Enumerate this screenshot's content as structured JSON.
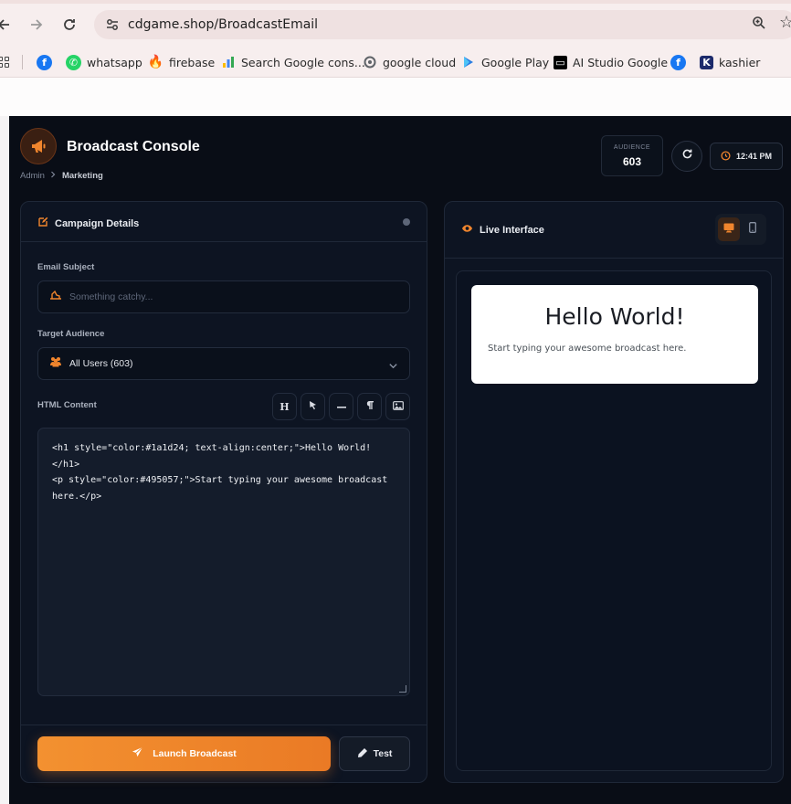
{
  "browser": {
    "url": "cdgame.shop/BroadcastEmail",
    "bookmarks": [
      {
        "label": "",
        "icon": "facebook-icon",
        "color": "#1877f2"
      },
      {
        "label": "whatsapp",
        "icon": "whatsapp-icon",
        "color": "#25d366"
      },
      {
        "label": "firebase",
        "icon": "firebase-icon",
        "color": "#f5820d"
      },
      {
        "label": "Search Google cons...",
        "icon": "google-ads-icon",
        "color": "#4285f4"
      },
      {
        "label": "google cloud",
        "icon": "google-cloud-icon",
        "color": "#5f6368"
      },
      {
        "label": "Google Play",
        "icon": "google-play-icon",
        "color": "#2a7de1"
      },
      {
        "label": "AI Studio Google",
        "icon": "ai-studio-icon",
        "color": "#000000"
      },
      {
        "label": "",
        "icon": "facebook-icon",
        "color": "#1877f2"
      },
      {
        "label": "kashier",
        "icon": "kashier-icon",
        "color": "#1c2a6b"
      }
    ]
  },
  "header": {
    "title": "Broadcast Console",
    "breadcrumb": [
      "Admin",
      "Marketing"
    ],
    "audience_label": "AUDIENCE",
    "audience_value": "603",
    "time": "12:41 PM",
    "accent": "#f0852d"
  },
  "campaign": {
    "title": "Campaign Details",
    "subject_label": "Email Subject",
    "subject_placeholder": "Something catchy...",
    "subject_value": "",
    "audience_label": "Target Audience",
    "audience_selected": "All Users (603)",
    "content_label": "HTML Content",
    "toolbar": [
      "H",
      "pointer-icon",
      "divider-icon",
      "paragraph-icon",
      "image-icon"
    ],
    "html_content": "<h1 style=\"color:#1a1d24; text-align:center;\">Hello World!</h1>\n<p style=\"color:#495057;\">Start typing your awesome broadcast here.</p>",
    "launch_label": "Launch Broadcast",
    "test_label": "Test"
  },
  "preview": {
    "title": "Live Interface",
    "heading": "Hello World!",
    "paragraph": "Start typing your awesome broadcast here.",
    "heading_color": "#1a1d24",
    "paragraph_color": "#495057"
  }
}
